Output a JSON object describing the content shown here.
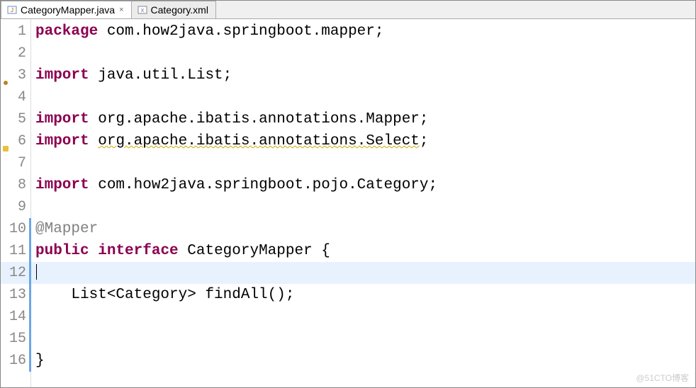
{
  "tabs": [
    {
      "name": "CategoryMapper.java",
      "active": true,
      "close": "×",
      "iconType": "java"
    },
    {
      "name": "Category.xml",
      "active": false,
      "close": "",
      "iconType": "xml"
    }
  ],
  "gutter": {
    "lines": [
      "1",
      "2",
      "3",
      "4",
      "5",
      "6",
      "7",
      "8",
      "9",
      "10",
      "11",
      "12",
      "13",
      "14",
      "15",
      "16"
    ],
    "importMarker": 3,
    "warningMarker": 6,
    "foldRange": [
      10,
      16
    ],
    "activeLine": 12
  },
  "code": {
    "l1": {
      "kw1": "package",
      "rest": " com.how2java.springboot.mapper;"
    },
    "l3": {
      "kw1": "import",
      "rest": " java.util.List;"
    },
    "l5": {
      "kw1": "import",
      "rest": " org.apache.ibatis.annotations.Mapper;"
    },
    "l6": {
      "kw1": "import",
      "pre": " ",
      "warn": "org.apache.ibatis.annotations.Select",
      "post": ";"
    },
    "l8": {
      "kw1": "import",
      "rest": " com.how2java.springboot.pojo.Category;"
    },
    "l10": {
      "ann": "@Mapper"
    },
    "l11": {
      "kw1": "public",
      "sp1": " ",
      "kw2": "interface",
      "rest": " CategoryMapper {"
    },
    "l13": {
      "rest": "    List<Category> findAll();"
    },
    "l16": {
      "rest": "}"
    }
  },
  "watermark": "@51CTO博客"
}
